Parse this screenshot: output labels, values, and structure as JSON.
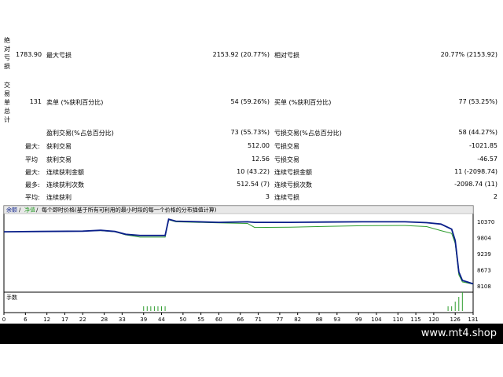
{
  "report": {
    "drawdown": {
      "side_label": "绝对亏损",
      "absolute_value": "1783.90",
      "max_label": "最大亏损",
      "max_value": "2153.92 (20.77%)",
      "relative_label": "相对亏损",
      "relative_value": "20.77% (2153.92)"
    },
    "trades": {
      "side_label": "交易单总计",
      "total": "131",
      "short_label": "卖单 (%获利百分比)",
      "short_value": "54 (59.26%)",
      "long_label": "买单 (%获利百分比)",
      "long_value": "77 (53.25%)"
    },
    "rows": [
      {
        "prefix": "",
        "l_label": "盈利交易(%占总百分比)",
        "l_value": "73 (55.73%)",
        "r_label": "亏损交易(%占总百分比)",
        "r_value": "58 (44.27%)"
      },
      {
        "prefix": "最大:",
        "l_label": "获利交易",
        "l_value": "512.00",
        "r_label": "亏损交易",
        "r_value": "-1021.85"
      },
      {
        "prefix": "平均",
        "l_label": "获利交易",
        "l_value": "12.56",
        "r_label": "亏损交易",
        "r_value": "-46.57"
      },
      {
        "prefix": "最大:",
        "l_label": "连续获利金额",
        "l_value": "10 (43.22)",
        "r_label": "连续亏损金额",
        "r_value": "11 (-2098.74)"
      },
      {
        "prefix": "最多:",
        "l_label": "连续获利次数",
        "l_value": "512.54 (7)",
        "r_label": "连续亏损次数",
        "r_value": "-2098.74 (11)"
      },
      {
        "prefix": "平均:",
        "l_label": "连续获利",
        "l_value": "3",
        "r_label": "连续亏损",
        "r_value": "2"
      }
    ]
  },
  "chart": {
    "legend_balance": "余额",
    "legend_sep1": " / ",
    "legend_equity": "净值",
    "legend_sep2": " / ",
    "legend_text": "每个即时价格(基于所有可利用的最小时段的每一个价格的分布插值计算)",
    "lots_label": "手数"
  },
  "chart_data": {
    "type": "line",
    "ylim": [
      8108,
      10370
    ],
    "yticks": [
      "10370",
      "9804",
      "9239",
      "8673",
      "8108"
    ],
    "xticks": [
      "0",
      "6",
      "12",
      "17",
      "22",
      "28",
      "33",
      "39",
      "44",
      "50",
      "55",
      "60",
      "66",
      "71",
      "77",
      "82",
      "88",
      "93",
      "99",
      "104",
      "110",
      "115",
      "120",
      "126",
      "131"
    ],
    "xlim": [
      0,
      131
    ],
    "series": [
      {
        "values": [
          [
            0,
            10010
          ],
          [
            10,
            10020
          ],
          [
            22,
            10030
          ],
          [
            27,
            10060
          ],
          [
            31,
            10020
          ],
          [
            34,
            9920
          ],
          [
            38,
            9880
          ],
          [
            45,
            9880
          ],
          [
            46,
            10450
          ],
          [
            48,
            10380
          ],
          [
            60,
            10340
          ],
          [
            68,
            10360
          ],
          [
            70,
            10340
          ],
          [
            80,
            10340
          ],
          [
            90,
            10350
          ],
          [
            100,
            10360
          ],
          [
            112,
            10360
          ],
          [
            118,
            10330
          ],
          [
            122,
            10280
          ],
          [
            125,
            10100
          ],
          [
            126,
            9700
          ],
          [
            127,
            8600
          ],
          [
            128,
            8300
          ],
          [
            131,
            8180
          ]
        ]
      },
      {
        "values": [
          [
            0,
            10010
          ],
          [
            10,
            10020
          ],
          [
            22,
            10030
          ],
          [
            27,
            10050
          ],
          [
            31,
            10010
          ],
          [
            34,
            9900
          ],
          [
            38,
            9820
          ],
          [
            45,
            9820
          ],
          [
            46,
            10430
          ],
          [
            48,
            10360
          ],
          [
            60,
            10320
          ],
          [
            68,
            10300
          ],
          [
            70,
            10160
          ],
          [
            80,
            10170
          ],
          [
            90,
            10200
          ],
          [
            100,
            10220
          ],
          [
            112,
            10230
          ],
          [
            118,
            10190
          ],
          [
            122,
            10050
          ],
          [
            125,
            9950
          ],
          [
            126,
            9600
          ],
          [
            127,
            8500
          ],
          [
            128,
            8250
          ],
          [
            131,
            8170
          ]
        ]
      }
    ],
    "lots": [
      [
        39,
        1
      ],
      [
        40,
        1
      ],
      [
        41,
        1
      ],
      [
        42,
        1
      ],
      [
        43,
        1
      ],
      [
        44,
        1
      ],
      [
        45,
        1
      ],
      [
        124,
        1
      ],
      [
        125,
        1
      ],
      [
        126,
        2
      ],
      [
        127,
        3
      ],
      [
        128,
        4
      ]
    ],
    "colors": {
      "balance": "#0a1f8a",
      "equity": "#2e9d2e",
      "lots": "#2e9d2e"
    }
  },
  "footer": {
    "watermark": "www.mt4.shop"
  }
}
